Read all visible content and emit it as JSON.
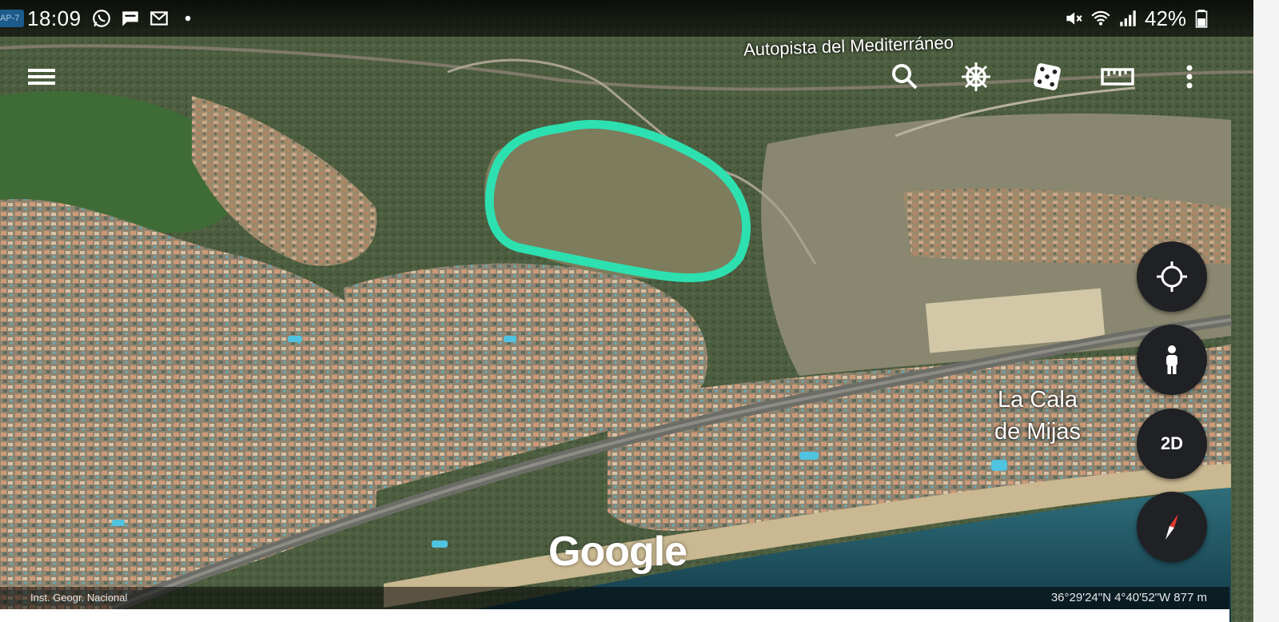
{
  "status_bar": {
    "time": "18:09",
    "notification_icons": [
      "whatsapp-icon",
      "message-icon",
      "gmail-icon",
      "dot-icon"
    ],
    "system_icons": [
      "mute-icon",
      "wifi-icon",
      "signal-icon"
    ],
    "battery_percent": "42%",
    "corner_chip_text": "AP-7"
  },
  "toolbar": {
    "icons": [
      "menu-icon",
      "search-icon",
      "voyager-ship-wheel-icon",
      "feeling-lucky-dice-icon",
      "measure-ruler-icon",
      "more-vert-icon"
    ]
  },
  "map": {
    "road_label": "Autopista del Mediterráneo",
    "place_label_line1": "La Cala",
    "place_label_line2": "de Mijas",
    "logo_text": "Google",
    "annotation_color": "#2de0b0",
    "sea_color": "#1d4a58"
  },
  "controls": {
    "buttons": [
      "my-location-icon",
      "street-view-pegman-icon",
      "2D",
      "compass-icon"
    ]
  },
  "bottom_bar": {
    "attribution": "Inst. Geogr. Nacional",
    "coordinates": "36°29'24\"N 4°40'52\"W 877 m"
  }
}
